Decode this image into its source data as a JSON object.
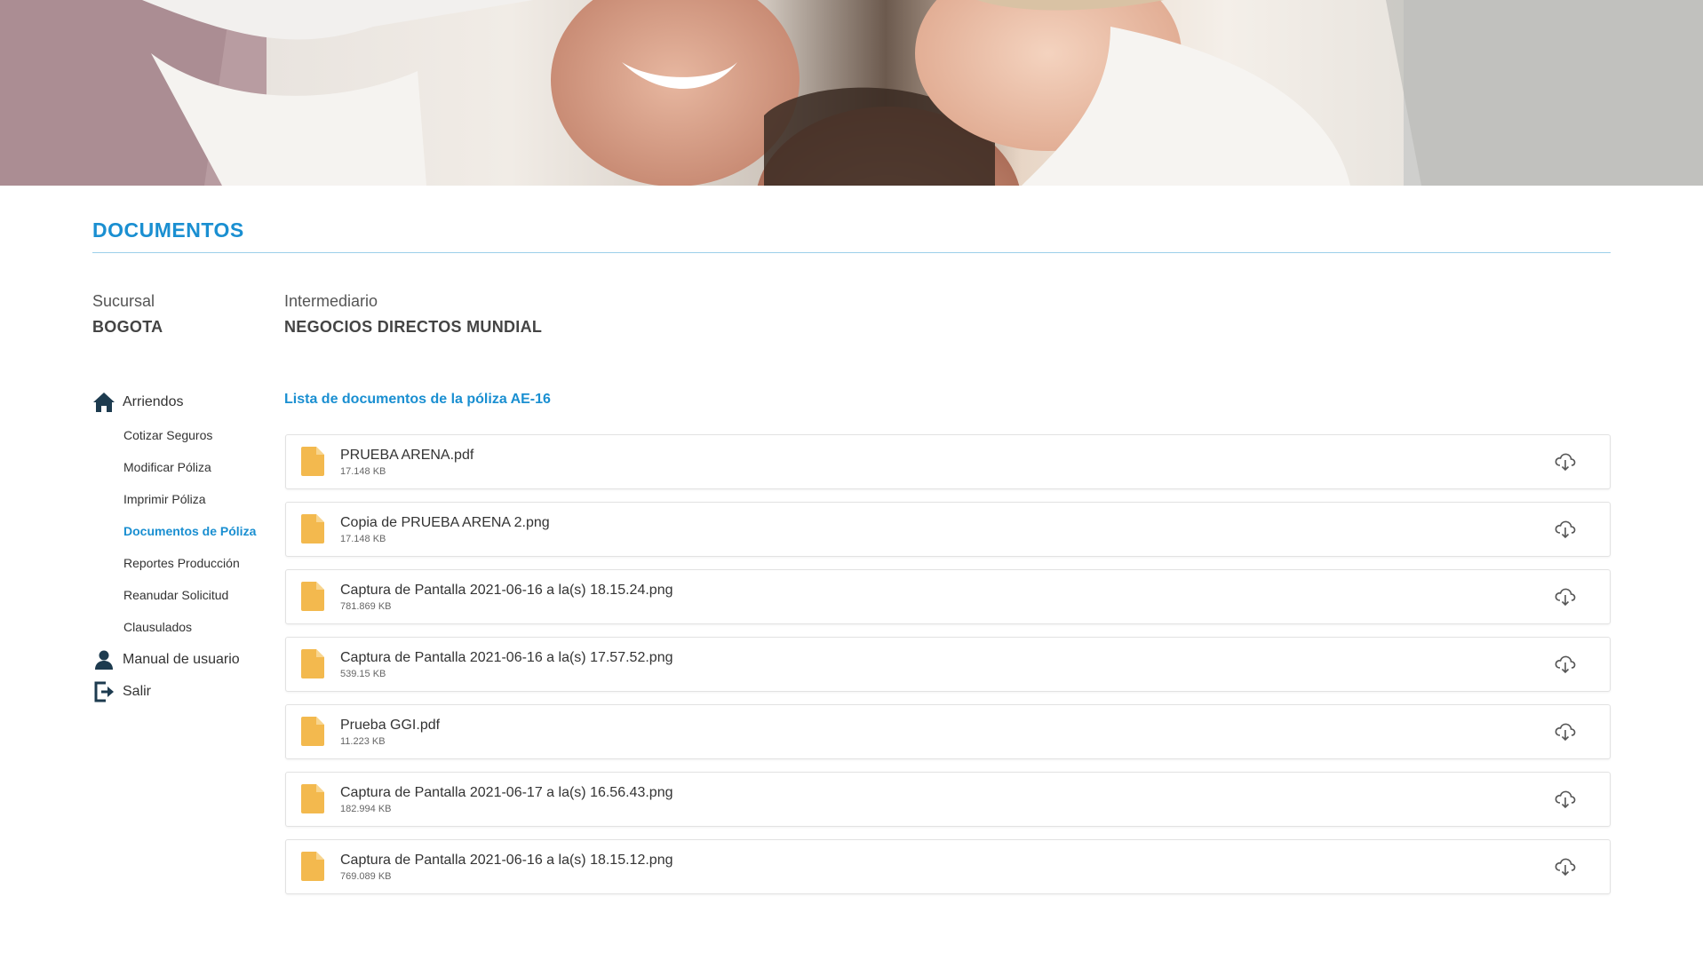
{
  "header": {
    "title": "DOCUMENTOS"
  },
  "info": {
    "sucursal": {
      "label": "Sucursal",
      "value": "BOGOTA"
    },
    "intermediario": {
      "label": "Intermediario",
      "value": "NEGOCIOS DIRECTOS MUNDIAL"
    }
  },
  "sidebar": {
    "main": {
      "label": "Arriendos",
      "icon": "home-icon"
    },
    "items": [
      {
        "label": "Cotizar Seguros"
      },
      {
        "label": "Modificar Póliza"
      },
      {
        "label": "Imprimir Póliza"
      },
      {
        "label": "Documentos de Póliza",
        "active": true
      },
      {
        "label": "Reportes Producción"
      },
      {
        "label": "Reanudar Solicitud"
      },
      {
        "label": "Clausulados"
      }
    ],
    "manual": {
      "label": "Manual de usuario",
      "icon": "user-icon"
    },
    "logout": {
      "label": "Salir",
      "icon": "logout-icon"
    }
  },
  "documents": {
    "title": "Lista de documentos de la póliza AE-16",
    "items": [
      {
        "name": "PRUEBA ARENA.pdf",
        "size": "17.148 KB"
      },
      {
        "name": "Copia de PRUEBA ARENA 2.png",
        "size": "17.148 KB"
      },
      {
        "name": "Captura de Pantalla 2021-06-16 a la(s) 18.15.24.png",
        "size": "781.869 KB"
      },
      {
        "name": "Captura de Pantalla 2021-06-16 a la(s) 17.57.52.png",
        "size": "539.15 KB"
      },
      {
        "name": "Prueba GGI.pdf",
        "size": "11.223 KB"
      },
      {
        "name": "Captura de Pantalla 2021-06-17 a la(s) 16.56.43.png",
        "size": "182.994 KB"
      },
      {
        "name": "Captura de Pantalla 2021-06-16 a la(s) 18.15.12.png",
        "size": "769.089 KB"
      }
    ]
  },
  "colors": {
    "accent": "#1a8fd1",
    "file_icon": "#f3b94e",
    "nav_icon": "#1d3b4f"
  }
}
